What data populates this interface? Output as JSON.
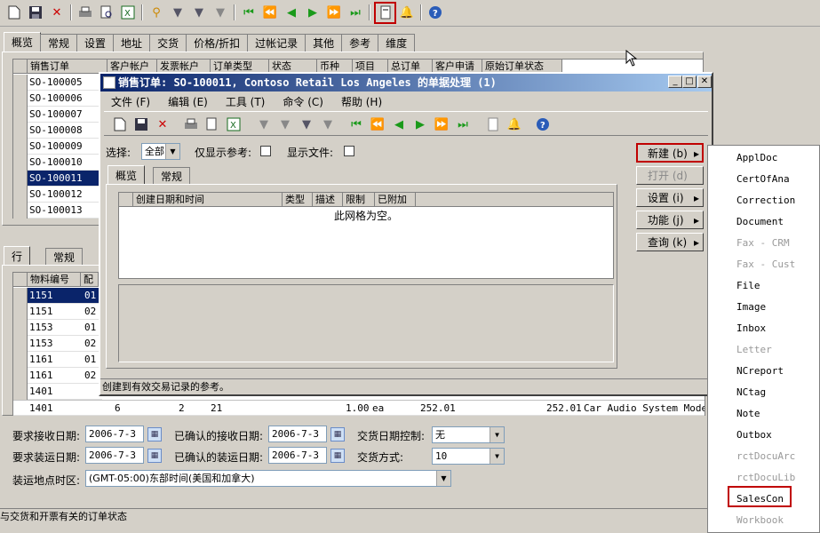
{
  "toolbar": {
    "icons": [
      "new-icon",
      "save-icon",
      "delete-icon",
      "print-icon",
      "print-preview-icon",
      "export-excel-icon",
      "filter-selection-icon",
      "filter-advanced-icon",
      "filter-sort-icon",
      "remove-filter-icon",
      "first-record-icon",
      "prev-page-icon",
      "prev-record-icon",
      "next-record-icon",
      "next-page-icon",
      "last-record-icon",
      "document-handling-icon",
      "alert-icon",
      "help-icon"
    ]
  },
  "main_tabs": [
    "概览",
    "常规",
    "设置",
    "地址",
    "交货",
    "价格/折扣",
    "过帐记录",
    "其他",
    "参考",
    "维度"
  ],
  "orders_grid": {
    "headers": [
      "销售订单",
      "客户帐户",
      "发票帐户",
      "订单类型",
      "状态",
      "币种",
      "项目",
      "总订单",
      "客户申请",
      "原始订单状态"
    ],
    "rows": [
      "SO-100005",
      "SO-100006",
      "SO-100007",
      "SO-100008",
      "SO-100009",
      "SO-100010",
      "SO-100011",
      "SO-100012",
      "SO-100013"
    ],
    "selected_index": 6
  },
  "line_tabs": [
    "行",
    "常规"
  ],
  "lines_grid": {
    "headers": [
      "物料编号",
      "配"
    ],
    "rows": [
      [
        "1151",
        "01"
      ],
      [
        "1151",
        "02"
      ],
      [
        "1153",
        "01"
      ],
      [
        "1153",
        "02"
      ],
      [
        "1161",
        "01"
      ],
      [
        "1161",
        "02"
      ],
      [
        "1401",
        ""
      ]
    ],
    "last_row": [
      "1401",
      "6",
      "2",
      "21",
      "1.00",
      "ea",
      "252.01",
      "252.01",
      "Car Audio System Mode..."
    ]
  },
  "fields": {
    "req_receipt_label": "要求接收日期:",
    "req_receipt_value": "2006-7-3",
    "conf_receipt_label": "已确认的接收日期:",
    "conf_receipt_value": "2006-7-3",
    "delivery_control_label": "交货日期控制:",
    "delivery_control_value": "无",
    "req_ship_label": "要求装运日期:",
    "req_ship_value": "2006-7-3",
    "conf_ship_label": "已确认的装运日期:",
    "conf_ship_value": "2006-7-3",
    "delivery_mode_label": "交货方式:",
    "delivery_mode_value": "10",
    "timezone_label": "装运地点时区:",
    "timezone_value": "(GMT-05:00)东部时间(美国和加拿大)"
  },
  "status_text": "与交货和开票有关的订单状态",
  "dialog": {
    "title": "销售订单: SO-100011, Contoso Retail Los Angeles 的单据处理 (1)",
    "menu": [
      "文件 (F)",
      "编辑 (E)",
      "工具 (T)",
      "命令 (C)",
      "帮助 (H)"
    ],
    "select_label": "选择:",
    "select_value": "全部",
    "show_ref_label": "仅显示参考:",
    "show_file_label": "显示文件:",
    "tabs": [
      "概览",
      "常规"
    ],
    "grid_headers": [
      "创建日期和时间",
      "类型",
      "描述",
      "限制",
      "已附加"
    ],
    "grid_empty": "此网格为空。",
    "status": "创建到有效交易记录的参考。"
  },
  "side_buttons": [
    {
      "label": "新建 (b)",
      "arrow": "▸"
    },
    {
      "label": "打开 (d)",
      "arrow": ""
    },
    {
      "label": "设置 (i)",
      "arrow": "▸"
    },
    {
      "label": "功能 (j)",
      "arrow": "▸"
    },
    {
      "label": "查询 (k)",
      "arrow": "▸"
    }
  ],
  "new_menu": [
    {
      "label": "ApplDoc",
      "disabled": false
    },
    {
      "label": "CertOfAna",
      "disabled": false
    },
    {
      "label": "Correction",
      "disabled": false
    },
    {
      "label": "Document",
      "disabled": false
    },
    {
      "label": "Fax - CRM",
      "disabled": true
    },
    {
      "label": "Fax - Cust",
      "disabled": true
    },
    {
      "label": "File",
      "disabled": false
    },
    {
      "label": "Image",
      "disabled": false
    },
    {
      "label": "Inbox",
      "disabled": false
    },
    {
      "label": "Letter",
      "disabled": true
    },
    {
      "label": "NCreport",
      "disabled": false
    },
    {
      "label": "NCtag",
      "disabled": false
    },
    {
      "label": "Note",
      "disabled": false
    },
    {
      "label": "Outbox",
      "disabled": false
    },
    {
      "label": "rctDocuArc",
      "disabled": true
    },
    {
      "label": "rctDocuLib",
      "disabled": true
    },
    {
      "label": "SalesCon",
      "disabled": false
    },
    {
      "label": "Workbook",
      "disabled": true
    }
  ]
}
